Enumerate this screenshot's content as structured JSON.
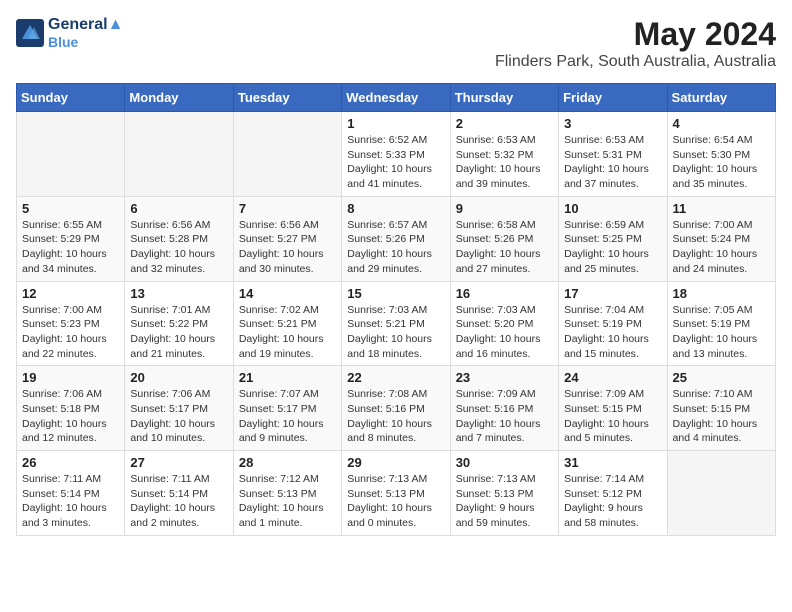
{
  "header": {
    "logo_line1": "General",
    "logo_line2": "Blue",
    "title": "May 2024",
    "subtitle": "Flinders Park, South Australia, Australia"
  },
  "days_of_week": [
    "Sunday",
    "Monday",
    "Tuesday",
    "Wednesday",
    "Thursday",
    "Friday",
    "Saturday"
  ],
  "weeks": [
    {
      "days": [
        {
          "num": "",
          "info": ""
        },
        {
          "num": "",
          "info": ""
        },
        {
          "num": "",
          "info": ""
        },
        {
          "num": "1",
          "info": "Sunrise: 6:52 AM\nSunset: 5:33 PM\nDaylight: 10 hours\nand 41 minutes."
        },
        {
          "num": "2",
          "info": "Sunrise: 6:53 AM\nSunset: 5:32 PM\nDaylight: 10 hours\nand 39 minutes."
        },
        {
          "num": "3",
          "info": "Sunrise: 6:53 AM\nSunset: 5:31 PM\nDaylight: 10 hours\nand 37 minutes."
        },
        {
          "num": "4",
          "info": "Sunrise: 6:54 AM\nSunset: 5:30 PM\nDaylight: 10 hours\nand 35 minutes."
        }
      ]
    },
    {
      "days": [
        {
          "num": "5",
          "info": "Sunrise: 6:55 AM\nSunset: 5:29 PM\nDaylight: 10 hours\nand 34 minutes."
        },
        {
          "num": "6",
          "info": "Sunrise: 6:56 AM\nSunset: 5:28 PM\nDaylight: 10 hours\nand 32 minutes."
        },
        {
          "num": "7",
          "info": "Sunrise: 6:56 AM\nSunset: 5:27 PM\nDaylight: 10 hours\nand 30 minutes."
        },
        {
          "num": "8",
          "info": "Sunrise: 6:57 AM\nSunset: 5:26 PM\nDaylight: 10 hours\nand 29 minutes."
        },
        {
          "num": "9",
          "info": "Sunrise: 6:58 AM\nSunset: 5:26 PM\nDaylight: 10 hours\nand 27 minutes."
        },
        {
          "num": "10",
          "info": "Sunrise: 6:59 AM\nSunset: 5:25 PM\nDaylight: 10 hours\nand 25 minutes."
        },
        {
          "num": "11",
          "info": "Sunrise: 7:00 AM\nSunset: 5:24 PM\nDaylight: 10 hours\nand 24 minutes."
        }
      ]
    },
    {
      "days": [
        {
          "num": "12",
          "info": "Sunrise: 7:00 AM\nSunset: 5:23 PM\nDaylight: 10 hours\nand 22 minutes."
        },
        {
          "num": "13",
          "info": "Sunrise: 7:01 AM\nSunset: 5:22 PM\nDaylight: 10 hours\nand 21 minutes."
        },
        {
          "num": "14",
          "info": "Sunrise: 7:02 AM\nSunset: 5:21 PM\nDaylight: 10 hours\nand 19 minutes."
        },
        {
          "num": "15",
          "info": "Sunrise: 7:03 AM\nSunset: 5:21 PM\nDaylight: 10 hours\nand 18 minutes."
        },
        {
          "num": "16",
          "info": "Sunrise: 7:03 AM\nSunset: 5:20 PM\nDaylight: 10 hours\nand 16 minutes."
        },
        {
          "num": "17",
          "info": "Sunrise: 7:04 AM\nSunset: 5:19 PM\nDaylight: 10 hours\nand 15 minutes."
        },
        {
          "num": "18",
          "info": "Sunrise: 7:05 AM\nSunset: 5:19 PM\nDaylight: 10 hours\nand 13 minutes."
        }
      ]
    },
    {
      "days": [
        {
          "num": "19",
          "info": "Sunrise: 7:06 AM\nSunset: 5:18 PM\nDaylight: 10 hours\nand 12 minutes."
        },
        {
          "num": "20",
          "info": "Sunrise: 7:06 AM\nSunset: 5:17 PM\nDaylight: 10 hours\nand 10 minutes."
        },
        {
          "num": "21",
          "info": "Sunrise: 7:07 AM\nSunset: 5:17 PM\nDaylight: 10 hours\nand 9 minutes."
        },
        {
          "num": "22",
          "info": "Sunrise: 7:08 AM\nSunset: 5:16 PM\nDaylight: 10 hours\nand 8 minutes."
        },
        {
          "num": "23",
          "info": "Sunrise: 7:09 AM\nSunset: 5:16 PM\nDaylight: 10 hours\nand 7 minutes."
        },
        {
          "num": "24",
          "info": "Sunrise: 7:09 AM\nSunset: 5:15 PM\nDaylight: 10 hours\nand 5 minutes."
        },
        {
          "num": "25",
          "info": "Sunrise: 7:10 AM\nSunset: 5:15 PM\nDaylight: 10 hours\nand 4 minutes."
        }
      ]
    },
    {
      "days": [
        {
          "num": "26",
          "info": "Sunrise: 7:11 AM\nSunset: 5:14 PM\nDaylight: 10 hours\nand 3 minutes."
        },
        {
          "num": "27",
          "info": "Sunrise: 7:11 AM\nSunset: 5:14 PM\nDaylight: 10 hours\nand 2 minutes."
        },
        {
          "num": "28",
          "info": "Sunrise: 7:12 AM\nSunset: 5:13 PM\nDaylight: 10 hours\nand 1 minute."
        },
        {
          "num": "29",
          "info": "Sunrise: 7:13 AM\nSunset: 5:13 PM\nDaylight: 10 hours\nand 0 minutes."
        },
        {
          "num": "30",
          "info": "Sunrise: 7:13 AM\nSunset: 5:13 PM\nDaylight: 9 hours\nand 59 minutes."
        },
        {
          "num": "31",
          "info": "Sunrise: 7:14 AM\nSunset: 5:12 PM\nDaylight: 9 hours\nand 58 minutes."
        },
        {
          "num": "",
          "info": ""
        }
      ]
    }
  ]
}
